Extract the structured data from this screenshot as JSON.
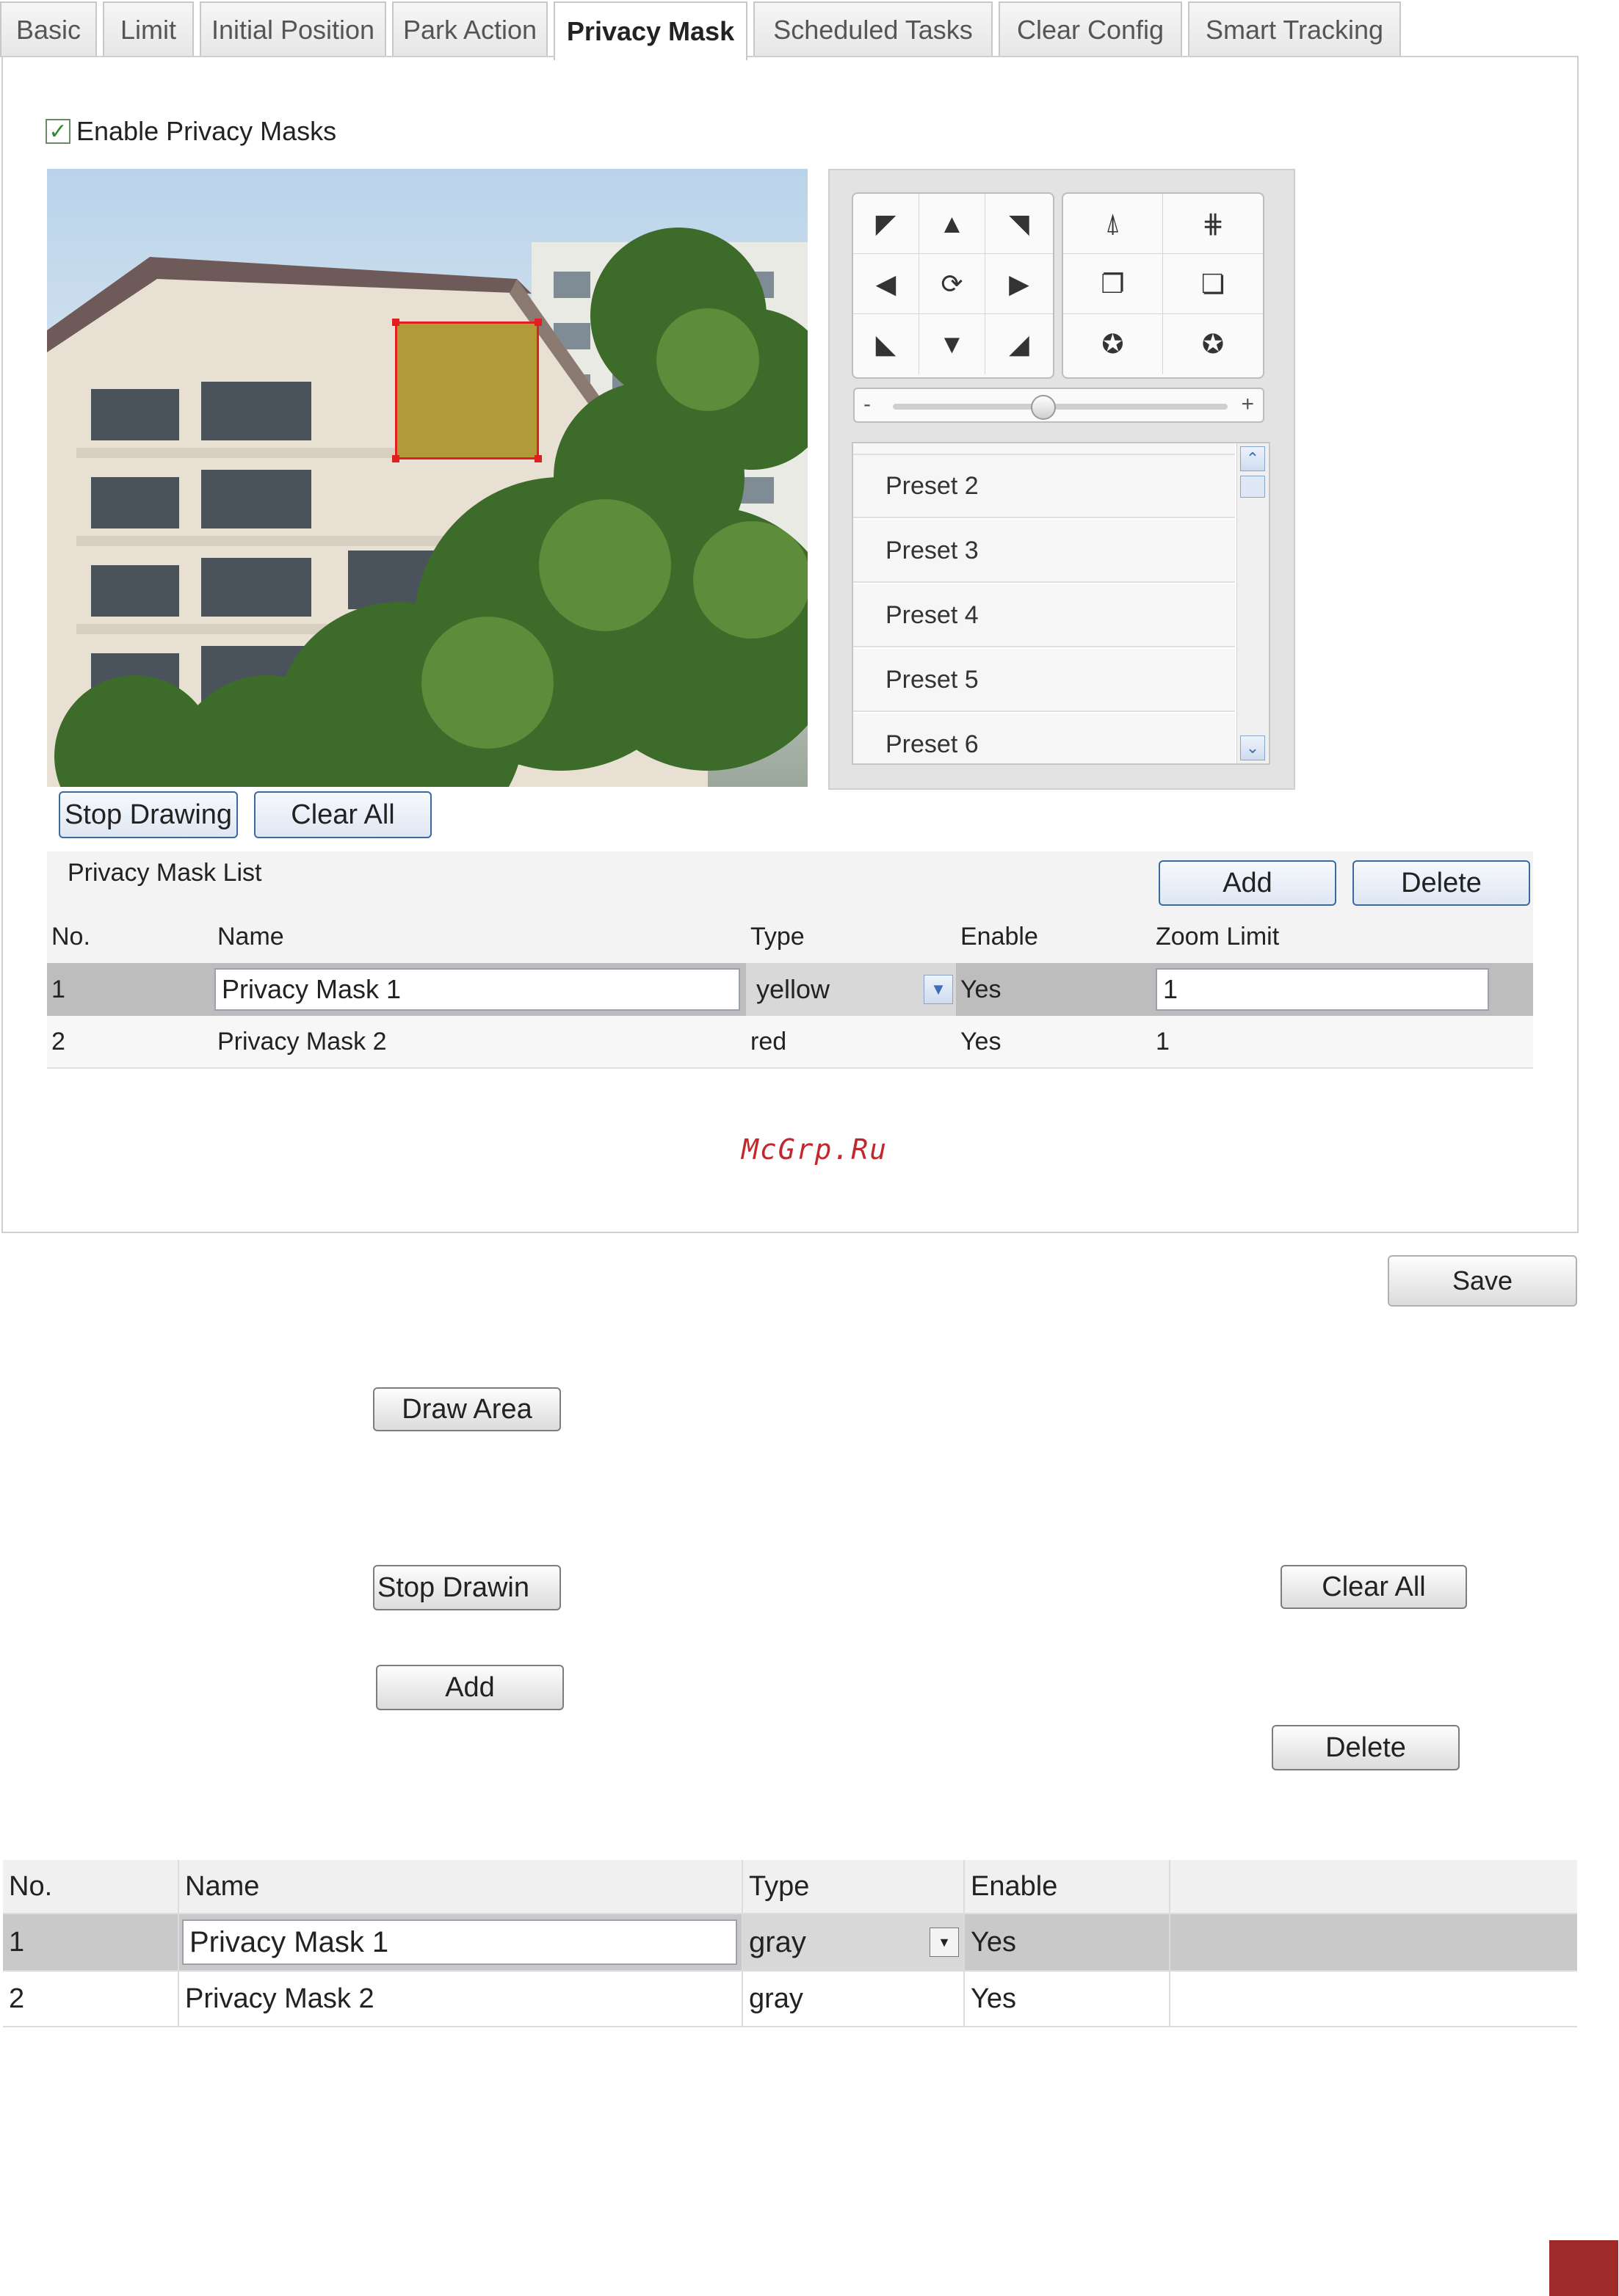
{
  "tabs": [
    "Basic",
    "Limit",
    "Initial Position",
    "Park Action",
    "Privacy Mask",
    "Scheduled Tasks",
    "Clear Config",
    "Smart Tracking"
  ],
  "active_tab": "Privacy Mask",
  "enable_privacy_masks": {
    "label": "Enable Privacy Masks",
    "checked": true
  },
  "ptz": {
    "presets": [
      "Preset 2",
      "Preset 3",
      "Preset 4",
      "Preset 5",
      "Preset 6"
    ],
    "slider_minus": "-",
    "slider_plus": "+",
    "slider_value": 0.45
  },
  "drawing_buttons": {
    "stop_drawing": "Stop Drawing",
    "clear_all": "Clear All"
  },
  "privacy_mask_list": {
    "title": "Privacy Mask List",
    "add": "Add",
    "delete": "Delete",
    "columns": [
      "No.",
      "Name",
      "Type",
      "Enable",
      "Zoom Limit"
    ],
    "rows": [
      {
        "no": "1",
        "name": "Privacy Mask 1",
        "type": "yellow",
        "enable": "Yes",
        "zoom_limit": "1"
      },
      {
        "no": "2",
        "name": "Privacy Mask 2",
        "type": "red",
        "enable": "Yes",
        "zoom_limit": "1"
      }
    ]
  },
  "watermark": "McGrp.Ru",
  "save": "Save",
  "standalone_buttons": {
    "draw_area": "Draw Area",
    "stop_drawing": "Stop Drawin",
    "clear_all": "Clear All",
    "add": "Add",
    "delete": "Delete"
  },
  "gray_table": {
    "columns": [
      "No.",
      "Name",
      "Type",
      "Enable"
    ],
    "rows": [
      {
        "no": "1",
        "name": "Privacy Mask 1",
        "type": "gray",
        "enable": "Yes"
      },
      {
        "no": "2",
        "name": "Privacy Mask 2",
        "type": "gray",
        "enable": "Yes"
      }
    ]
  },
  "colors": {
    "mask_fill": "#b19a38",
    "mask_border": "#e02020",
    "watermark": "#c0282d",
    "corner_block": "#9e2a2a"
  }
}
